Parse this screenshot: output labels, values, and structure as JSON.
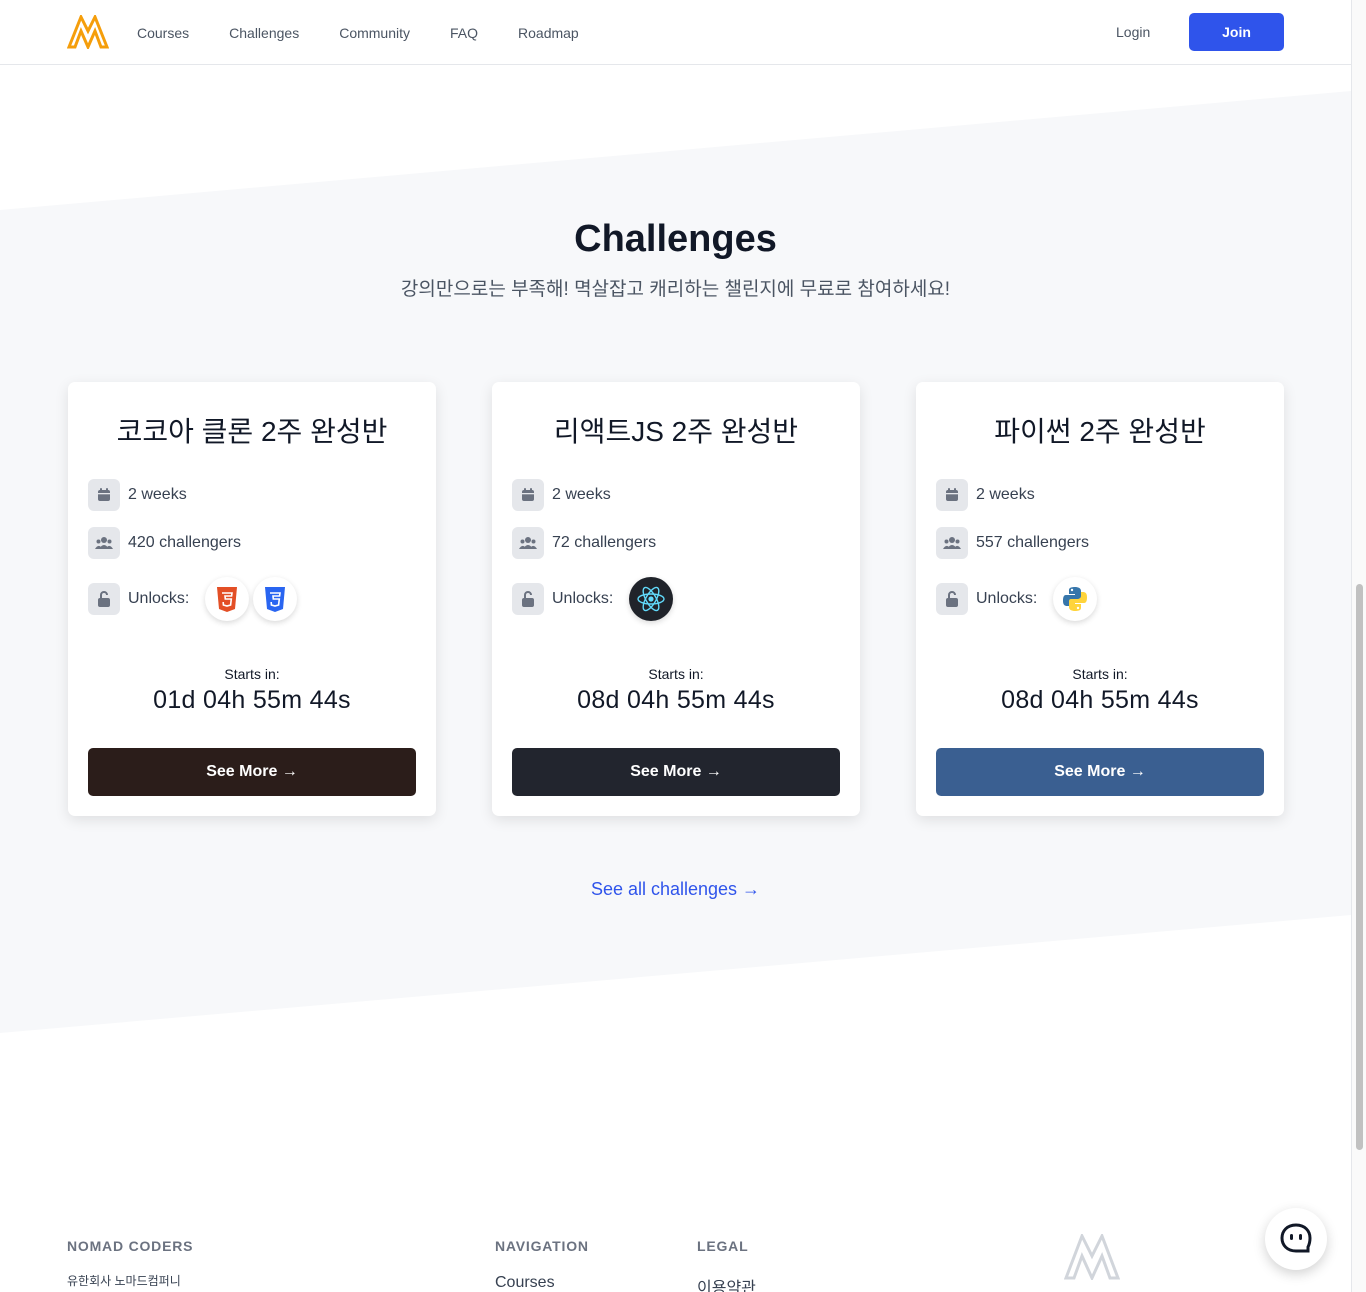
{
  "header": {
    "nav": [
      "Courses",
      "Challenges",
      "Community",
      "FAQ",
      "Roadmap"
    ],
    "login": "Login",
    "join": "Join"
  },
  "section": {
    "title": "Challenges",
    "subtitle": "강의만으로는 부족해! 멱살잡고 캐리하는 챌린지에 무료로 참여하세요!"
  },
  "cards": [
    {
      "title": "코코아 클론 2주 완성반",
      "duration": "2 weeks",
      "challengers": "420 challengers",
      "unlocks_label": "Unlocks:",
      "unlocks": [
        "html5-icon",
        "css3-icon"
      ],
      "starts_label": "Starts in:",
      "countdown": "01d 04h 55m 44s",
      "button": "See More →",
      "button_color": "#2b1d1a"
    },
    {
      "title": "리액트JS 2주 완성반",
      "duration": "2 weeks",
      "challengers": "72 challengers",
      "unlocks_label": "Unlocks:",
      "unlocks": [
        "react-icon"
      ],
      "starts_label": "Starts in:",
      "countdown": "08d 04h 55m 44s",
      "button": "See More →",
      "button_color": "#22252e"
    },
    {
      "title": "파이썬 2주 완성반",
      "duration": "2 weeks",
      "challengers": "557 challengers",
      "unlocks_label": "Unlocks:",
      "unlocks": [
        "python-icon"
      ],
      "starts_label": "Starts in:",
      "countdown": "08d 04h 55m 44s",
      "button": "See More →",
      "button_color": "#3a5f91"
    }
  ],
  "see_all": "See all challenges →",
  "footer": {
    "company_title": "NOMAD CODERS",
    "company_name": "유한회사 노마드컴퍼니",
    "nav_title": "NAVIGATION",
    "nav_first": "Courses",
    "legal_title": "LEGAL",
    "legal_first": "이용약관"
  },
  "colors": {
    "accent": "#2f54eb",
    "logo": "#f59e0b",
    "band": "#f7f8fa"
  }
}
